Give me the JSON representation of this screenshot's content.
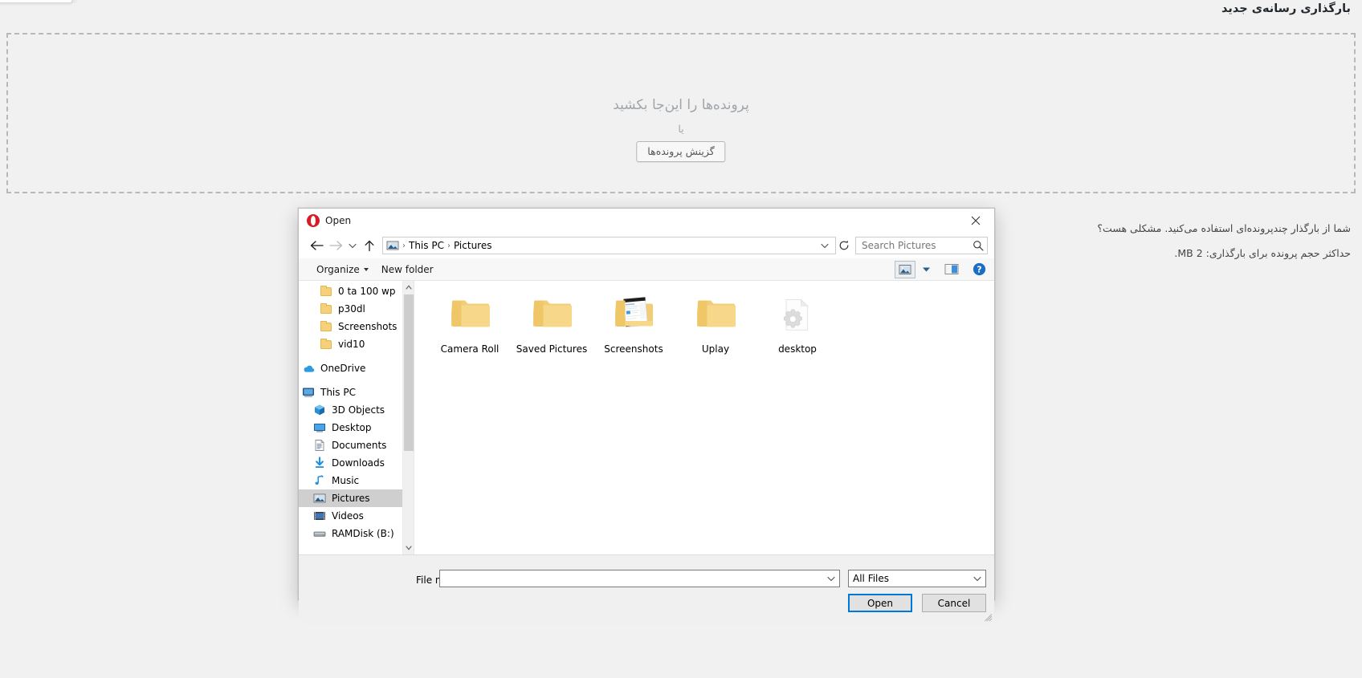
{
  "page": {
    "title": "بارگذاری رسانه‌ی جدید",
    "dropzone": {
      "main_text": "پرونده‌ها را این‌جا بکشید",
      "or_text": "یا",
      "select_button": "گزینش پرونده‌ها"
    },
    "notes": [
      "شما از بارگذار چندپرونده‌ای استفاده می‌کنید. مشکلی هست؟",
      "حداکثر حجم پرونده برای بارگذاری: 2 MB."
    ]
  },
  "dialog": {
    "title": "Open",
    "app_icon": "opera-icon",
    "close_label": "close-icon",
    "nav": {
      "back": "back-arrow-icon",
      "forward": "forward-arrow-icon",
      "recent": "chevron-down-icon",
      "up": "up-arrow-icon"
    },
    "address": {
      "icon": "pictures-folder-icon",
      "crumbs": [
        "This PC",
        "Pictures"
      ],
      "separator": "›",
      "dropdown": "chevron-down-icon",
      "refresh": "refresh-icon"
    },
    "search": {
      "placeholder": "Search Pictures",
      "icon": "search-icon"
    },
    "commandbar": {
      "organize": "Organize",
      "new_folder": "New folder",
      "view_icon": "view-icon",
      "view_chevron": "chevron-down-icon",
      "preview_pane_icon": "preview-pane-icon",
      "help_icon": "help-icon"
    },
    "sidebar": [
      {
        "label": "0 ta 100 wp",
        "icon": "folder-icon",
        "indent": 1,
        "selected": false
      },
      {
        "label": "p30dl",
        "icon": "folder-icon",
        "indent": 1,
        "selected": false
      },
      {
        "label": "Screenshots",
        "icon": "folder-icon",
        "indent": 1,
        "selected": false
      },
      {
        "label": "vid10",
        "icon": "folder-icon",
        "indent": 1,
        "selected": false
      },
      {
        "label": "OneDrive",
        "icon": "onedrive-icon",
        "indent": 0,
        "selected": false,
        "gap": true
      },
      {
        "label": "This PC",
        "icon": "this-pc-icon",
        "indent": 0,
        "selected": false,
        "gap": true
      },
      {
        "label": "3D Objects",
        "icon": "3d-objects-icon",
        "indent": 2,
        "selected": false
      },
      {
        "label": "Desktop",
        "icon": "desktop-icon",
        "indent": 2,
        "selected": false
      },
      {
        "label": "Documents",
        "icon": "documents-icon",
        "indent": 2,
        "selected": false
      },
      {
        "label": "Downloads",
        "icon": "downloads-icon",
        "indent": 2,
        "selected": false
      },
      {
        "label": "Music",
        "icon": "music-icon",
        "indent": 2,
        "selected": false
      },
      {
        "label": "Pictures",
        "icon": "pictures-icon",
        "indent": 2,
        "selected": true
      },
      {
        "label": "Videos",
        "icon": "videos-icon",
        "indent": 2,
        "selected": false
      },
      {
        "label": "RAMDisk (B:)",
        "icon": "drive-icon",
        "indent": 2,
        "selected": false
      }
    ],
    "files": [
      {
        "name": "Camera Roll",
        "type": "folder"
      },
      {
        "name": "Saved Pictures",
        "type": "folder"
      },
      {
        "name": "Screenshots",
        "type": "folder-screenshots"
      },
      {
        "name": "Uplay",
        "type": "folder"
      },
      {
        "name": "desktop",
        "type": "config-file"
      }
    ],
    "footer": {
      "file_name_label": "File name:",
      "file_name_value": "",
      "file_name_placeholder": "",
      "filter_value": "All Files",
      "open_button": "Open",
      "cancel_button": "Cancel"
    }
  },
  "colors": {
    "accent": "#0078d7",
    "folder": "#f7d88a",
    "opera_red": "#d81b24",
    "selected_row": "#cfcfcf"
  }
}
